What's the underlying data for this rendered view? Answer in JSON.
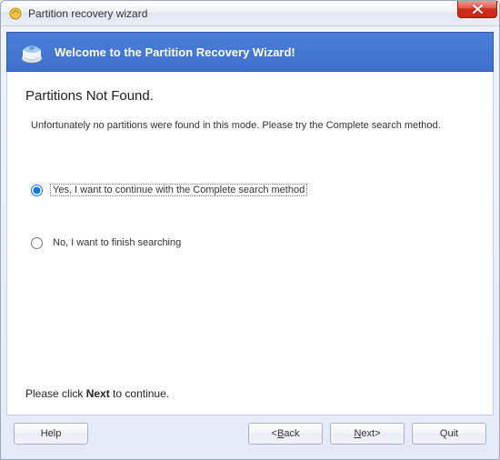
{
  "window": {
    "title": "Partition recovery wizard"
  },
  "banner": {
    "text": "Welcome to the Partition Recovery Wizard!"
  },
  "content": {
    "heading": "Partitions Not Found.",
    "body": "Unfortunately no partitions were found in this mode. Please try the Complete search method.",
    "option1": "Yes, I want to continue with the Complete search method",
    "option2": "No, I want to finish searching",
    "footer_prefix": "Please click ",
    "footer_bold": "Next",
    "footer_suffix": " to continue."
  },
  "buttons": {
    "help": "Help",
    "back_prefix": "<",
    "back_u": "B",
    "back_suffix": "ack",
    "next_u": "N",
    "next_suffix": "ext>",
    "quit": "Quit"
  }
}
